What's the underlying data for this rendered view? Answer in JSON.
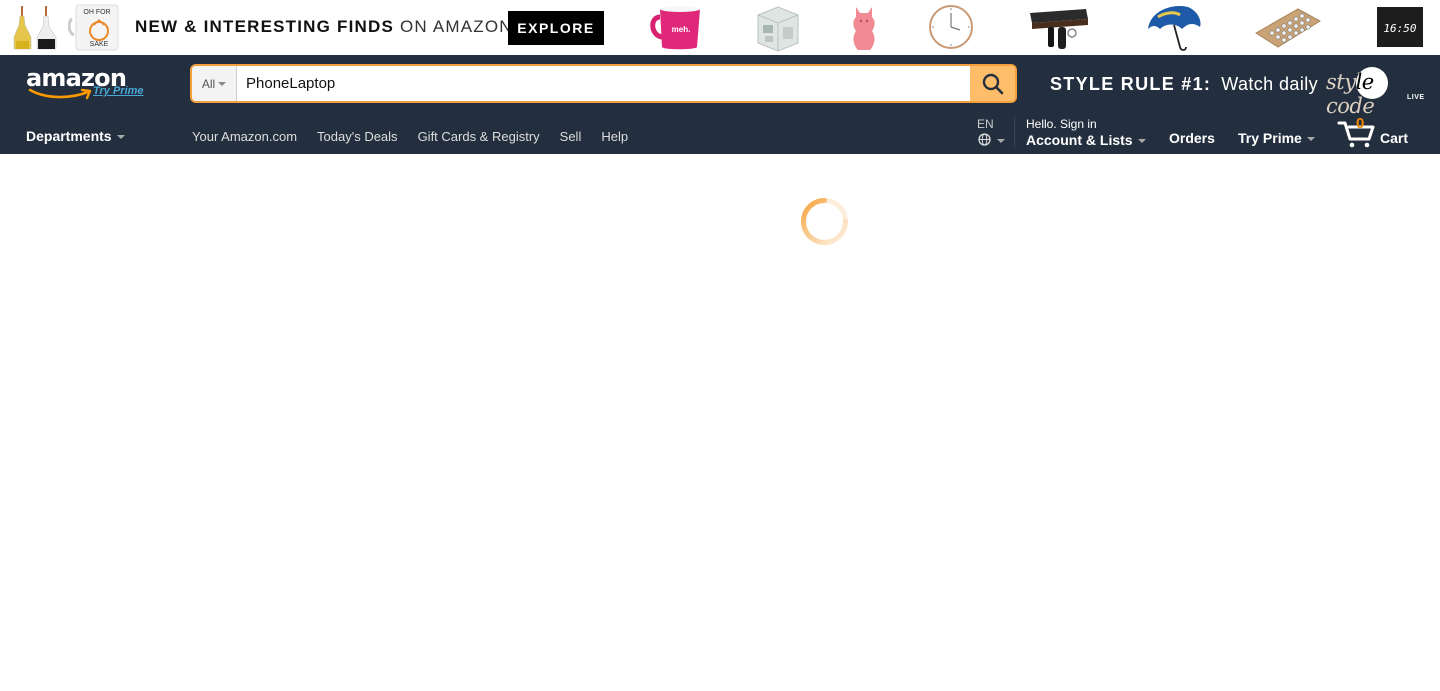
{
  "promo": {
    "headline_bold": "NEW & INTERESTING FINDS",
    "headline_light": "ON AMAZON",
    "button": "EXPLORE",
    "products": [
      "oil-bottles-icon",
      "sake-mug-icon",
      "meh-mug-icon",
      "storage-cube-icon",
      "pink-vase-icon",
      "wall-clock-icon",
      "key-shelf-icon",
      "umbrella-icon",
      "typewriter-keyboard-icon",
      "wood-clock-icon"
    ],
    "mug_text": "meh.",
    "sake_text_top": "OH FOR",
    "sake_text_bottom": "SAKE",
    "clock_text": "16:50"
  },
  "nav": {
    "logo_text": "amazon",
    "logo_sub": "Try Prime",
    "search": {
      "department": "All",
      "query": "PhoneLaptop"
    },
    "style_rule_bold": "STYLE RULE #1:",
    "style_rule_text": "Watch daily",
    "stylecode_script": "style code",
    "stylecode_live": "LIVE",
    "departments_label": "Departments",
    "links": [
      "Your Amazon.com",
      "Today's Deals",
      "Gift Cards & Registry",
      "Sell",
      "Help"
    ],
    "language": "EN",
    "greeting": "Hello. Sign in",
    "account_label": "Account & Lists",
    "orders_label": "Orders",
    "prime_label": "Try Prime",
    "cart_count": "0",
    "cart_label": "Cart"
  },
  "colors": {
    "nav_bg": "#232f3e",
    "search_button": "#febd69",
    "accent": "#f08804",
    "spinner": "#f7a13a"
  }
}
